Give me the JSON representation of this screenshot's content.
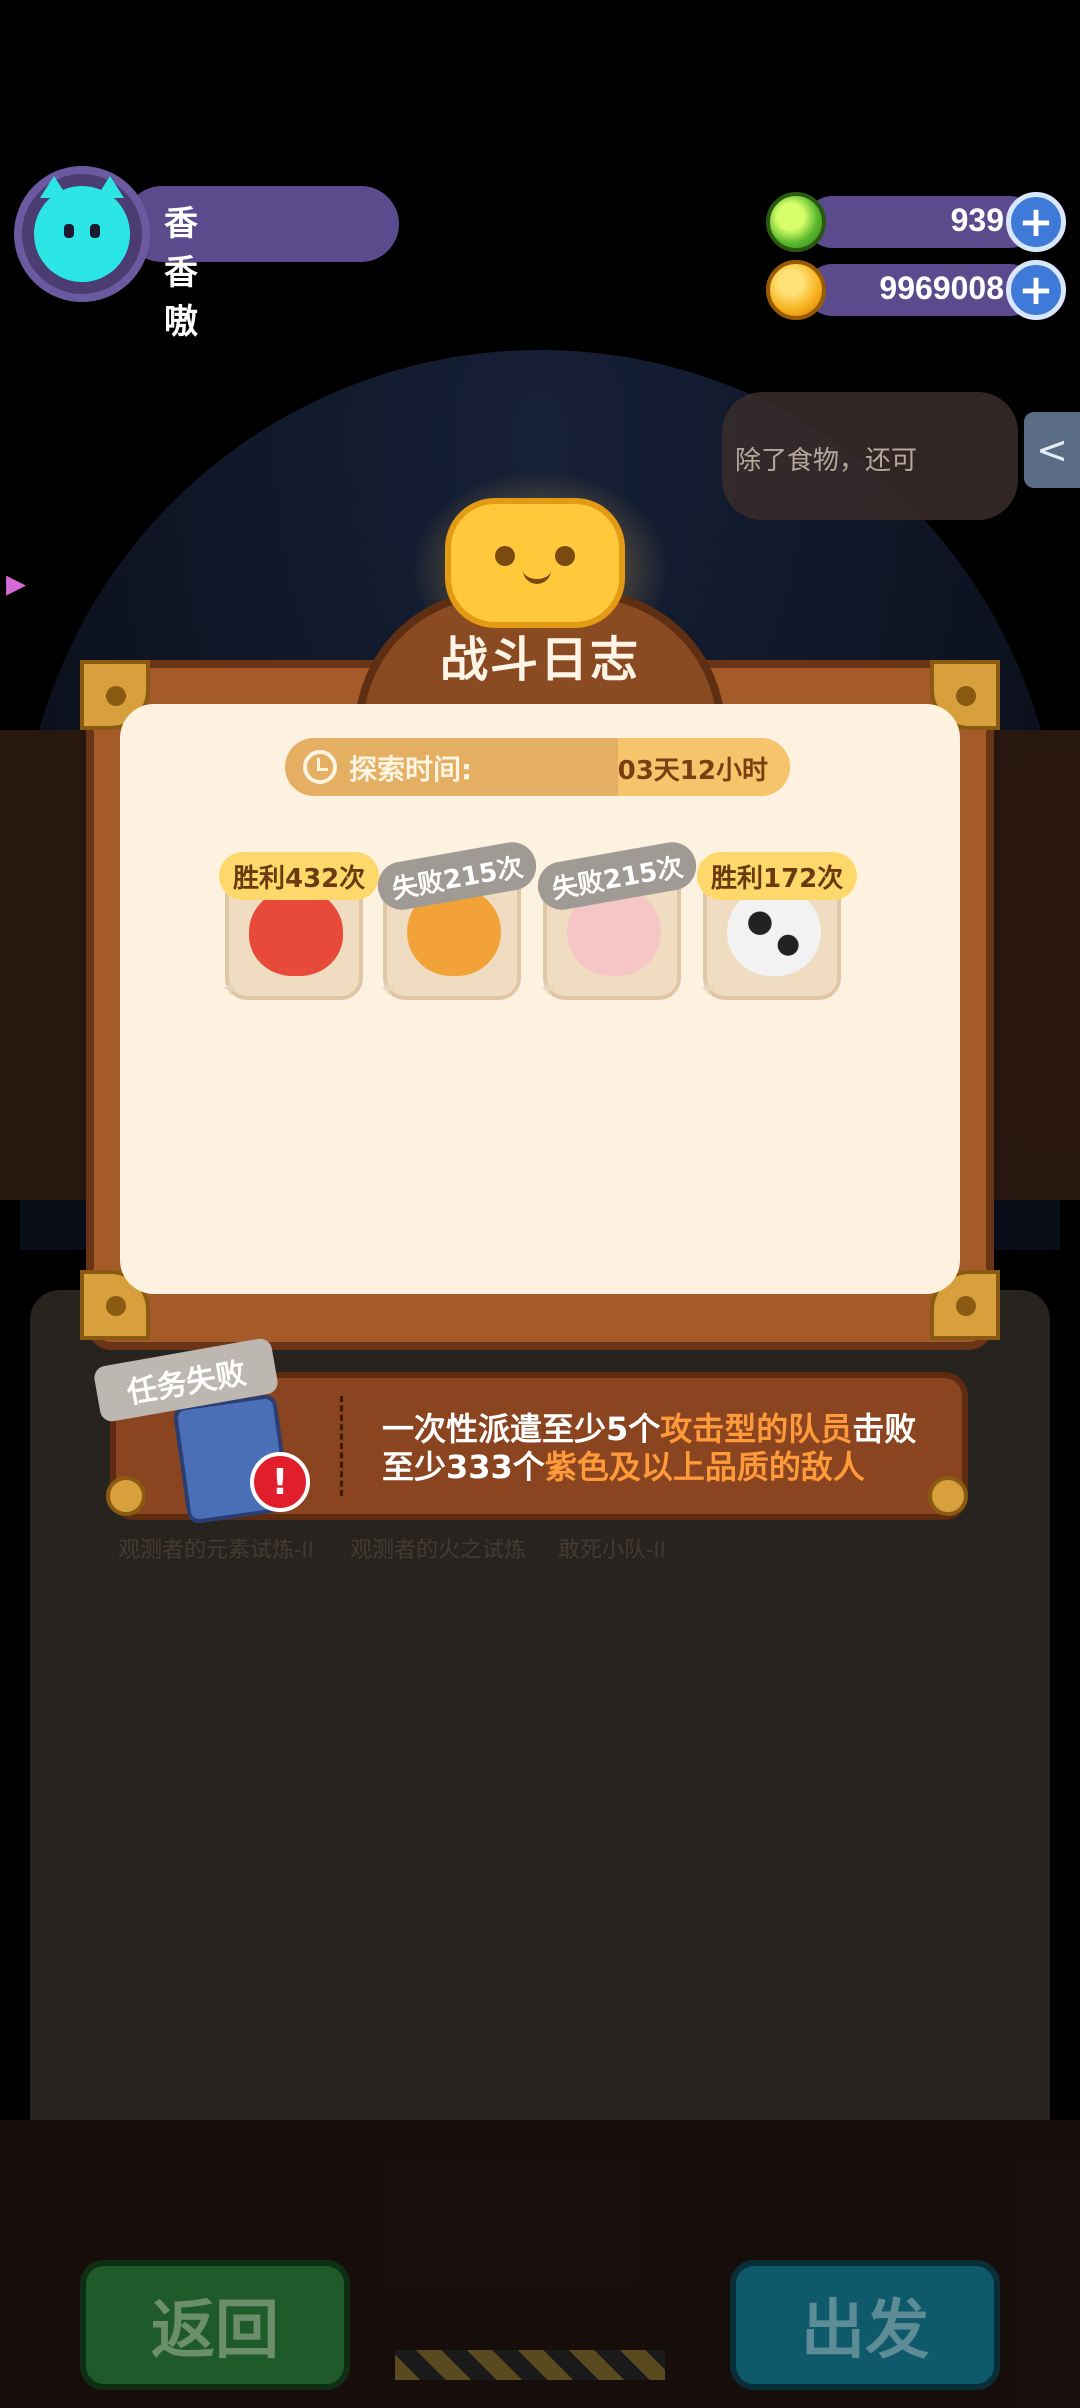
{
  "player": {
    "name": "香香嗷"
  },
  "currencies": [
    {
      "name": "gem",
      "value": "939"
    },
    {
      "name": "coin",
      "value": "9969008"
    }
  ],
  "speech_bubble": {
    "text": "除了食物，还可"
  },
  "background_labels": {
    "card1": "观测者的元素试炼-II",
    "card2": "观测者的火之试炼",
    "card3": "敢死小队-II"
  },
  "buttons": {
    "back": "返回",
    "depart": "出发"
  },
  "battle_log": {
    "title": "战斗日志",
    "explore_label": "探索时间:",
    "explore_value": "03天12小时",
    "items": [
      {
        "food": "strawberry",
        "result": "胜利432次",
        "outcome": "win",
        "color": "#e84a3a"
      },
      {
        "food": "croissant-duck",
        "result": "失败215次",
        "outcome": "lose",
        "color": "#f3a23a"
      },
      {
        "food": "candy-pink",
        "result": "失败215次",
        "outcome": "lose",
        "color": "#f6c6c6"
      },
      {
        "food": "candy-cow",
        "result": "胜利172次",
        "outcome": "win",
        "color": "#f2f2f2"
      }
    ]
  },
  "mission": {
    "status": "任务失败",
    "text_1": "一次性派遣至少5个",
    "highlight_1": "攻击型的队员",
    "text_2": "击败至少333个",
    "highlight_2": "紫色及以上品质的敌人"
  }
}
